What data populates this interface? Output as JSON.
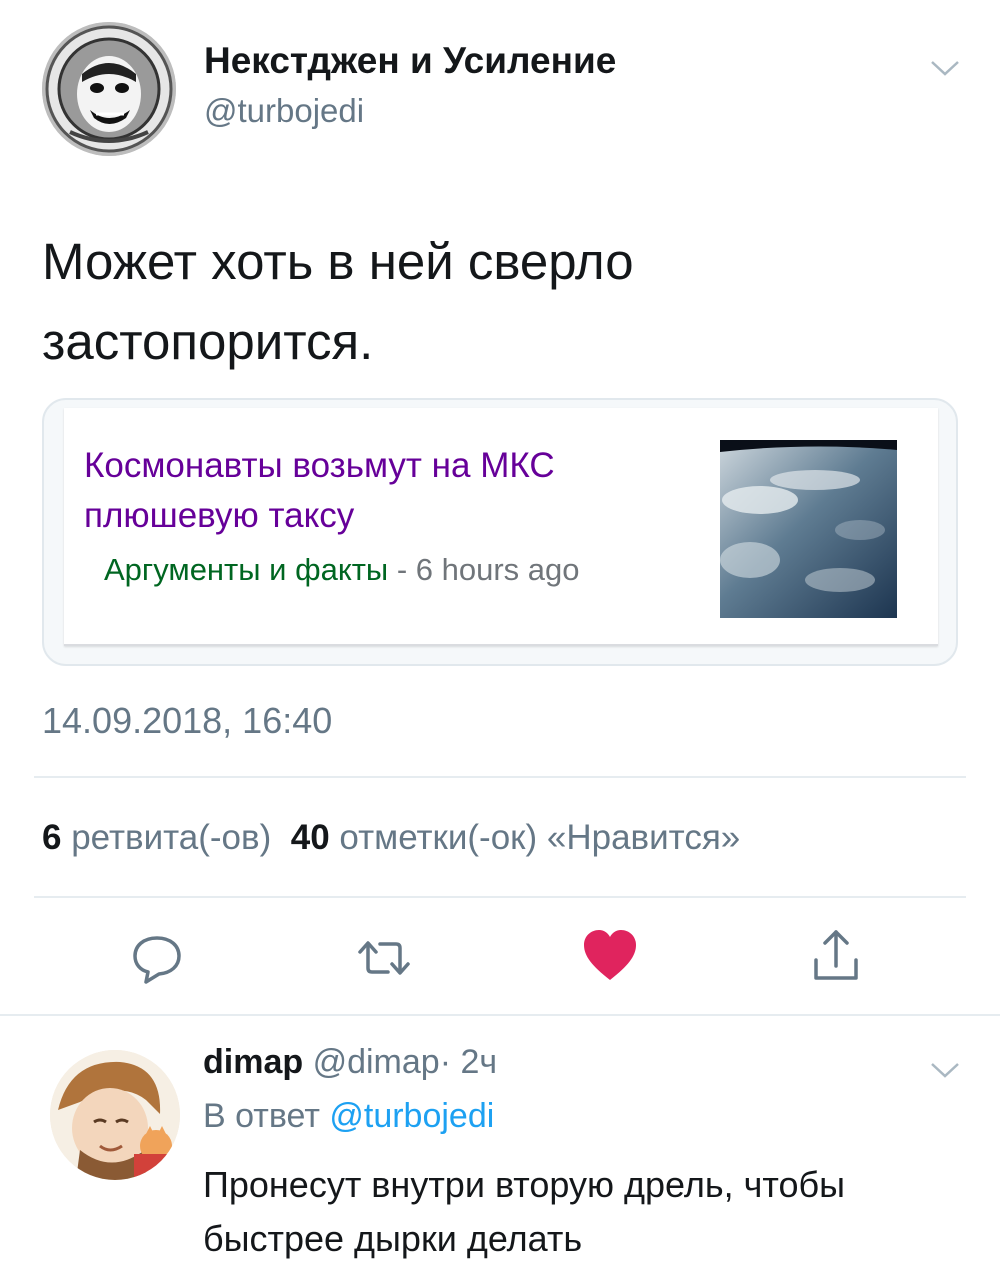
{
  "tweet": {
    "author": {
      "name": "Некстджен и Усиление",
      "handle": "@turbojedi"
    },
    "text": "Может хоть в ней сверло застопорится.",
    "card": {
      "title": "Космонавты возьмут на МКС плюшевую таксу",
      "source": "Аргументы и факты",
      "separator": " - ",
      "time": "6 hours ago"
    },
    "timestamp": "14.09.2018, 16:40",
    "stats": {
      "retweets_count": "6",
      "retweets_label": "ретвита(-ов)",
      "likes_count": "40",
      "likes_label": "отметки(-ок) «Нравится»"
    },
    "actions": [
      "reply-icon",
      "retweet-icon",
      "like-icon",
      "share-icon"
    ],
    "liked": true
  },
  "reply": {
    "name": "dimap",
    "handle": "@dimap",
    "dot": "·",
    "time": "2ч",
    "reply_to_prefix": "В ответ",
    "reply_to_handle": "@turbojedi",
    "text": "Пронесут внутри вторую дрель, чтобы быстрее дырки делать"
  },
  "colors": {
    "like": "#e0245e",
    "link": "#1da1f2",
    "card_title": "#660099",
    "card_source": "#006621",
    "secondary": "#657786"
  }
}
